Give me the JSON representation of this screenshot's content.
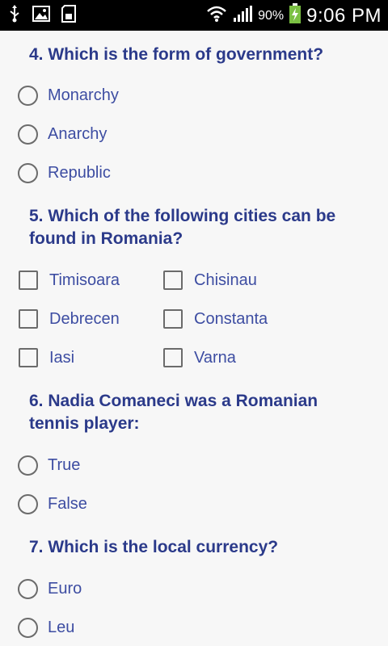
{
  "status_bar": {
    "battery_percent": "90%",
    "time": "9:06 PM",
    "icons": [
      "usb-icon",
      "image-icon",
      "sd-card-icon",
      "wifi-icon",
      "signal-icon",
      "battery-charging-icon"
    ]
  },
  "questions": [
    {
      "title": "4. Which is the form of government?",
      "type": "radio",
      "options": [
        "Monarchy",
        "Anarchy",
        "Republic"
      ]
    },
    {
      "title": "5. Which of the following cities can be found in Romania?",
      "type": "checkbox",
      "options": [
        "Timisoara",
        "Chisinau",
        "Debrecen",
        "Constanta",
        "Iasi",
        "Varna"
      ]
    },
    {
      "title": "6. Nadia Comaneci was a Romanian tennis player:",
      "type": "radio",
      "options": [
        "True",
        "False"
      ]
    },
    {
      "title": "7. Which is the local currency?",
      "type": "radio",
      "options": [
        "Euro",
        "Leu"
      ]
    }
  ]
}
